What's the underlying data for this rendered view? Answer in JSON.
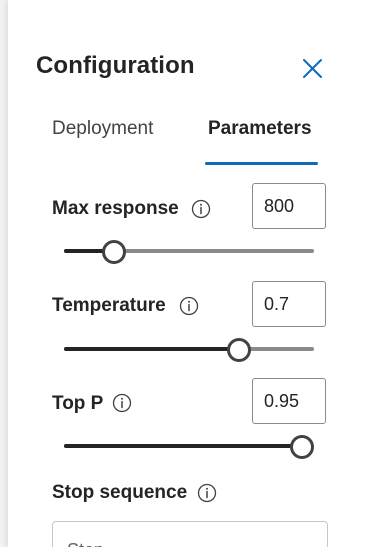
{
  "panel": {
    "title": "Configuration",
    "close_icon": "close-icon"
  },
  "tabs": [
    {
      "label": "Deployment",
      "selected": false
    },
    {
      "label": "Parameters",
      "selected": true
    }
  ],
  "parameters": {
    "max_response": {
      "label": "Max response",
      "value": "800",
      "slider_fraction": 0.2
    },
    "temperature": {
      "label": "Temperature",
      "value": "0.7",
      "slider_fraction": 0.7
    },
    "top_p": {
      "label": "Top P",
      "value": "0.95",
      "slider_fraction": 0.95
    },
    "stop_sequence": {
      "label": "Stop sequence",
      "placeholder": "Stop"
    }
  },
  "colors": {
    "accent": "#0f6cbd",
    "text": "#242424",
    "slider_fill": "#242424",
    "slider_rail": "#8a8a8a"
  }
}
